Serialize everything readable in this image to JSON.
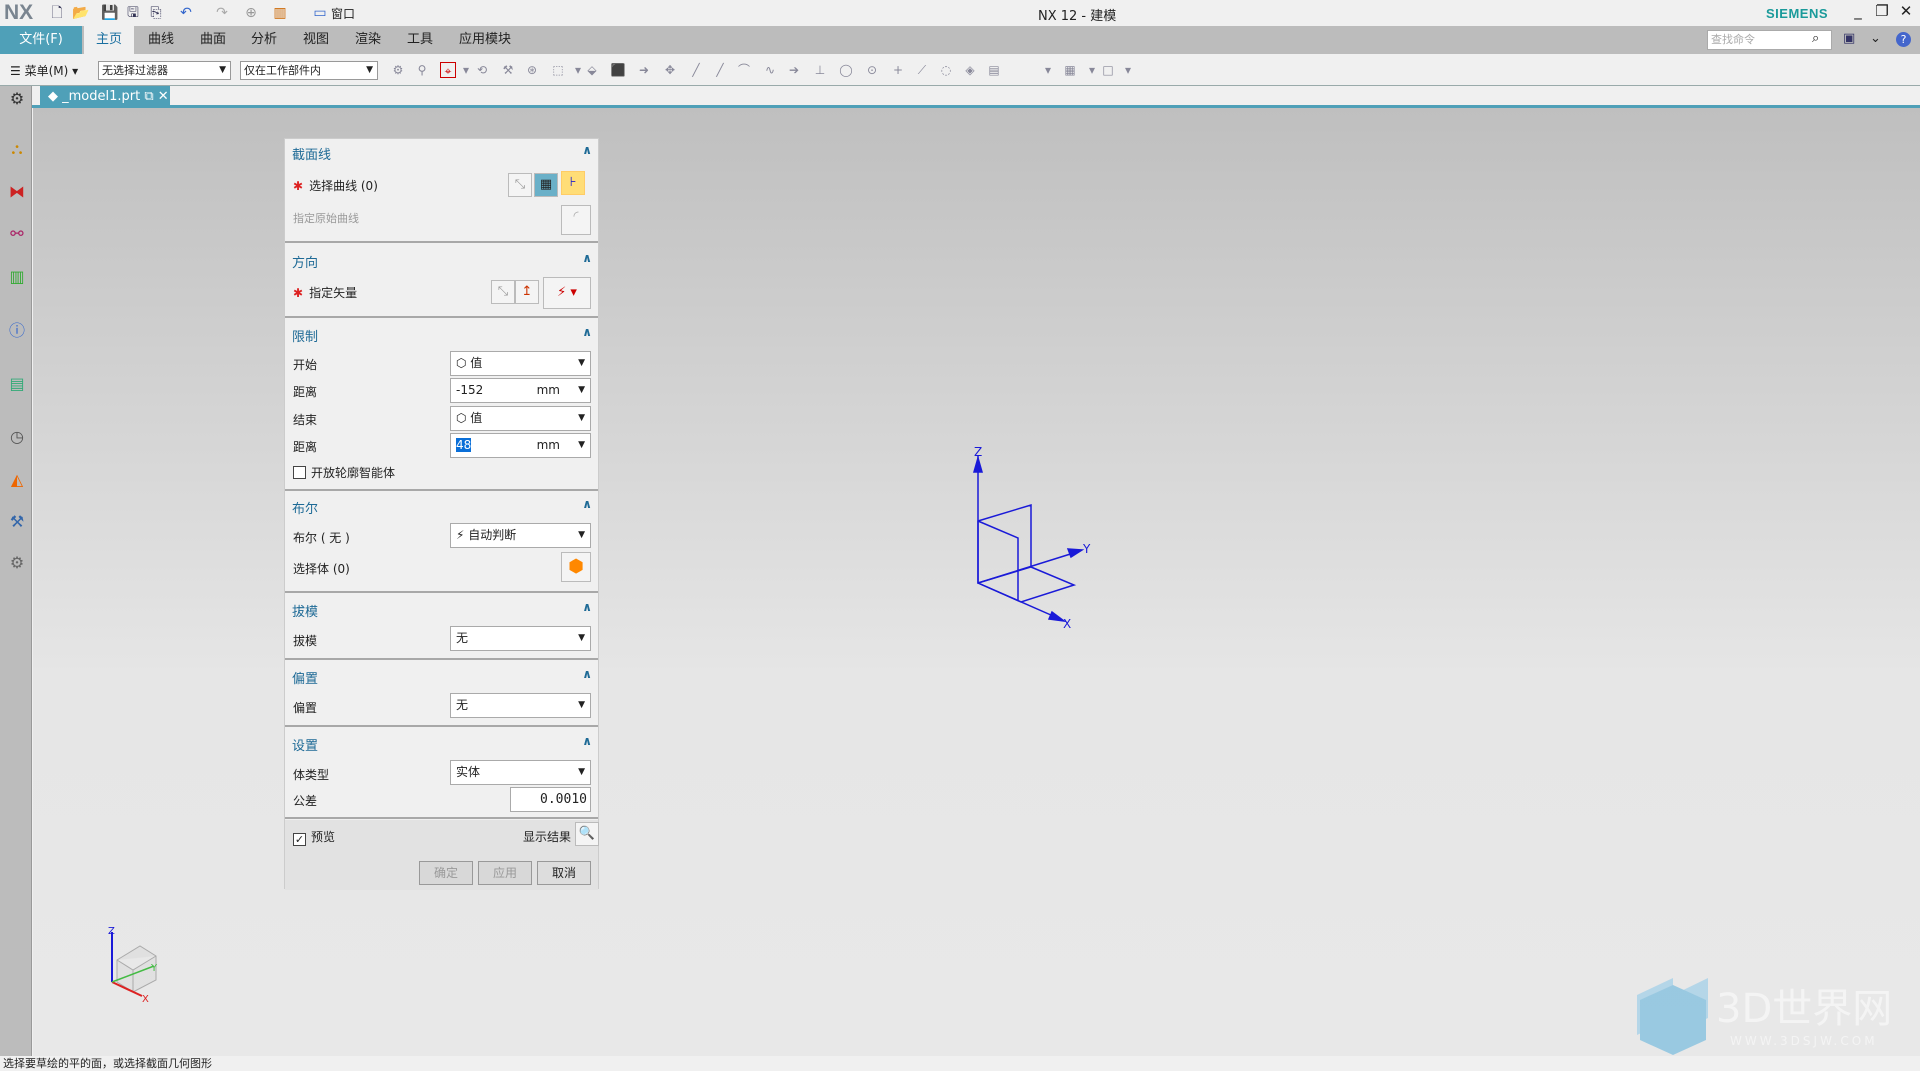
{
  "app": {
    "logo": "NX",
    "title": "NX 12 - 建模",
    "brand": "SIEMENS",
    "window_menu": "窗口"
  },
  "ribbon": {
    "file_tab": "文件(F)",
    "tabs": [
      "主页",
      "曲线",
      "曲面",
      "分析",
      "视图",
      "渲染",
      "工具",
      "应用模块"
    ],
    "active_tab": "主页",
    "search_placeholder": "查找命令"
  },
  "toolbar": {
    "menu_label": "菜单(M)",
    "filter": "无选择过滤器",
    "scope": "仅在工作部件内"
  },
  "document_tab": {
    "name": "_model1.prt"
  },
  "dialog": {
    "section_curve": {
      "title": "截面线",
      "select_curve": "选择曲线 (0)",
      "original_curve": "指定原始曲线"
    },
    "direction": {
      "title": "方向",
      "vector": "指定矢量"
    },
    "limits": {
      "title": "限制",
      "start_label": "开始",
      "start_value": "值",
      "start_distance_label": "距离",
      "start_distance": "-152",
      "end_label": "结束",
      "end_value": "值",
      "end_distance_label": "距离",
      "end_distance": "48",
      "unit": "mm",
      "open_profile": "开放轮廓智能体",
      "open_profile_checked": false
    },
    "boolean": {
      "title": "布尔",
      "label": "布尔 ( 无 )",
      "value": "自动判断",
      "select_body": "选择体 (0)"
    },
    "draft": {
      "title": "拔模",
      "label": "拔模",
      "value": "无"
    },
    "offset": {
      "title": "偏置",
      "label": "偏置",
      "value": "无"
    },
    "settings": {
      "title": "设置",
      "body_type_label": "体类型",
      "body_type": "实体",
      "tolerance_label": "公差",
      "tolerance": "0.0010"
    },
    "preview_label": "预览",
    "preview_checked": true,
    "show_result": "显示结果",
    "ok": "确定",
    "apply": "应用",
    "cancel": "取消"
  },
  "viewport": {
    "axes": {
      "x": "X",
      "y": "Y",
      "z": "Z"
    },
    "watermark": "3D世界网",
    "watermark_url": "WWW.3DSJW.COM"
  },
  "status": {
    "message": "选择要草绘的平的面，或选择截面几何图形"
  },
  "colors": {
    "accent": "#4fa0b8",
    "section_title": "#1e6a96",
    "axis": "#1a1ad8"
  }
}
